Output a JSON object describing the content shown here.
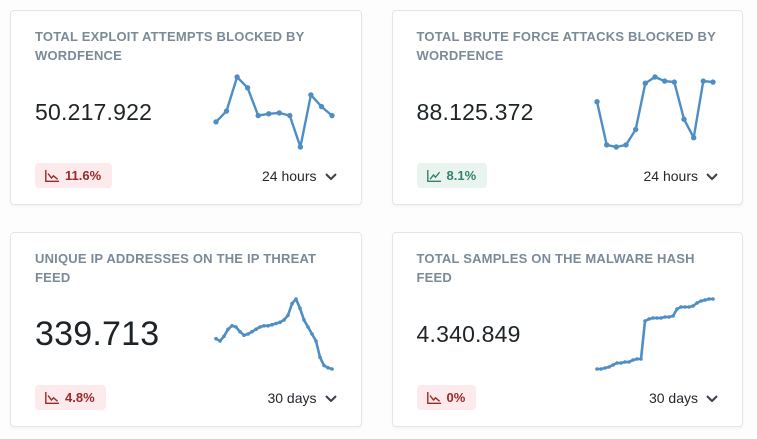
{
  "colors": {
    "sparkline_blue": "#4e8ec5",
    "badge_down_text": "#9a2a2a",
    "badge_down_bg": "#fceaec",
    "badge_up_text": "#34806f",
    "badge_up_bg": "#e9f4ee",
    "title_gray": "#7b8a99",
    "value_dark": "#1d2327"
  },
  "cards": [
    {
      "title": "TOTAL EXPLOIT ATTEMPTS BLOCKED BY WORDFENCE",
      "value": "50.217.922",
      "value_size": "normal",
      "change": {
        "label": "11.6%",
        "direction": "down"
      },
      "period": "24 hours"
    },
    {
      "title": "TOTAL BRUTE FORCE ATTACKS BLOCKED BY WORDFENCE",
      "value": "88.125.372",
      "value_size": "normal",
      "change": {
        "label": "8.1%",
        "direction": "up"
      },
      "period": "24 hours"
    },
    {
      "title": "UNIQUE IP ADDRESSES ON THE IP THREAT FEED",
      "value": "339.713",
      "value_size": "large",
      "change": {
        "label": "4.8%",
        "direction": "down"
      },
      "period": "30 days"
    },
    {
      "title": "TOTAL SAMPLES ON THE MALWARE HASH FEED",
      "value": "4.340.849",
      "value_size": "normal",
      "change": {
        "label": "0%",
        "direction": "down"
      },
      "period": "30 days"
    }
  ],
  "chart_data": [
    {
      "type": "line",
      "name": "Total exploit attempts blocked by Wordfence (24 hours)",
      "values": [
        38,
        50,
        88,
        76,
        45,
        47,
        48,
        45,
        10,
        68,
        55,
        45
      ],
      "ylim": [
        0,
        100
      ],
      "axes": false,
      "line_color": "#4e8ec5",
      "line_width": 2.4,
      "point_radius": 2.7
    },
    {
      "type": "line",
      "name": "Total brute force attacks blocked by Wordfence (24 hours)",
      "values": [
        62,
        20,
        18,
        20,
        35,
        80,
        86,
        82,
        81,
        45,
        27,
        82,
        81
      ],
      "ylim": [
        0,
        100
      ],
      "axes": false,
      "line_color": "#4e8ec5",
      "line_width": 2.4,
      "point_radius": 2.7
    },
    {
      "type": "line",
      "name": "Unique IP addresses on the IP threat feed (30 days)",
      "values": [
        52,
        50,
        54,
        60,
        63,
        62,
        58,
        55,
        56,
        58,
        60,
        62,
        63,
        63,
        64,
        65,
        66,
        68,
        72,
        82,
        86,
        78,
        68,
        62,
        56,
        50,
        36,
        29,
        27,
        26
      ],
      "ylim": [
        0,
        100
      ],
      "axes": false,
      "line_color": "#4e8ec5",
      "line_width": 2.6,
      "point_radius": 1.8
    },
    {
      "type": "line",
      "name": "Total samples on the malware hash feed (30 days)",
      "values": [
        10,
        10,
        11,
        12,
        14,
        16,
        16,
        17,
        17,
        19,
        20,
        20,
        58,
        60,
        61,
        61,
        61,
        62,
        62,
        63,
        70,
        72,
        72,
        72,
        73,
        76,
        78,
        79,
        80,
        80
      ],
      "ylim": [
        0,
        100
      ],
      "axes": false,
      "line_color": "#4e8ec5",
      "line_width": 2.6,
      "point_radius": 1.8
    }
  ]
}
